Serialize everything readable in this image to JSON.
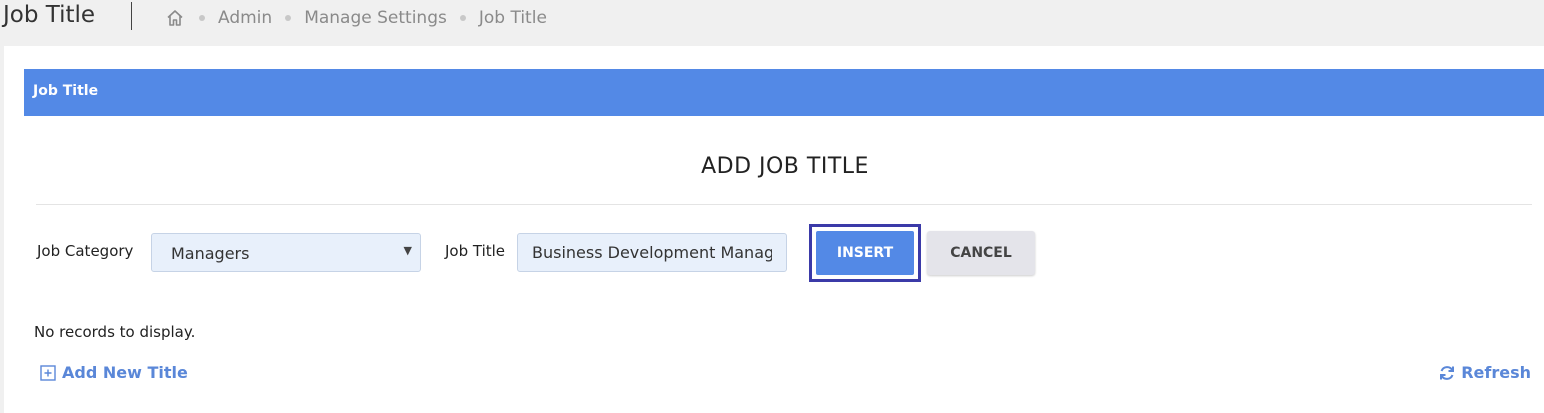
{
  "page": {
    "title": "Job Title"
  },
  "breadcrumb": {
    "items": [
      "Admin",
      "Manage Settings",
      "Job Title"
    ]
  },
  "panel": {
    "header": "Job Title"
  },
  "form": {
    "title": "ADD JOB TITLE",
    "category_label": "Job Category",
    "category_value": "Managers",
    "title_label": "Job Title",
    "title_value": "Business Development Manager",
    "insert_label": "INSERT",
    "cancel_label": "CANCEL"
  },
  "grid": {
    "empty_text": "No records to display.",
    "add_label": "Add New Title",
    "refresh_label": "Refresh"
  },
  "colors": {
    "accent": "#5389e6",
    "link": "#5a87d8",
    "focus_ring": "#3b3aa8"
  },
  "icons": {
    "home": "home-icon",
    "add": "plus-square-icon",
    "refresh": "refresh-icon"
  }
}
